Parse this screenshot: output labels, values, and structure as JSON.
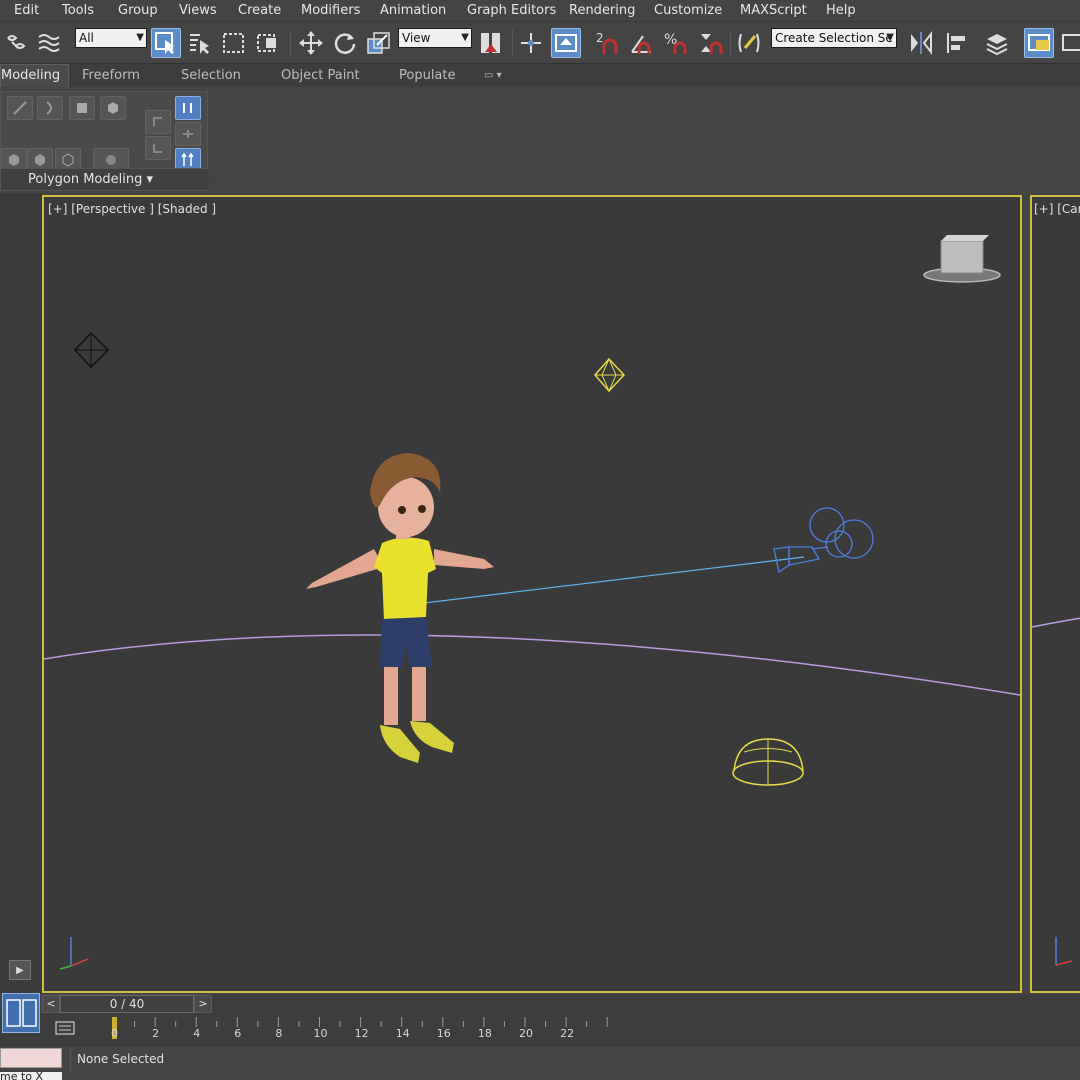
{
  "menu": {
    "items": [
      "Edit",
      "Tools",
      "Group",
      "Views",
      "Create",
      "Modifiers",
      "Animation",
      "Graph Editors",
      "Rendering",
      "Customize",
      "MAXScript",
      "Help"
    ]
  },
  "toolbar": {
    "selection_filter": "All",
    "reference_coord": "View",
    "named_selection": "Create Selection Se",
    "snap_label_2": "2",
    "percent_label": "%"
  },
  "ribbon": {
    "tabs": [
      "Modeling",
      "Freeform",
      "Selection",
      "Object Paint",
      "Populate"
    ],
    "active_tab": "Modeling",
    "group_label": "Polygon Modeling"
  },
  "viewport": {
    "label": "[+] [Perspective ] [Shaded ]",
    "side_label": "[+] [Cam"
  },
  "timeslider": {
    "frame_display": "0 / 40",
    "prev": "<",
    "next": ">"
  },
  "timeline": {
    "ticks": [
      "0",
      "2",
      "4",
      "6",
      "8",
      "10",
      "12",
      "14",
      "16",
      "18",
      "20",
      "22"
    ]
  },
  "status": {
    "selection_text": "None Selected",
    "script_hint": "me to X"
  },
  "colors": {
    "active_viewport_border": "#cfbf3c",
    "accent_blue": "#5b8cc8",
    "light_wire": "#e6d84a",
    "camera_wire": "#4f7ee0"
  }
}
